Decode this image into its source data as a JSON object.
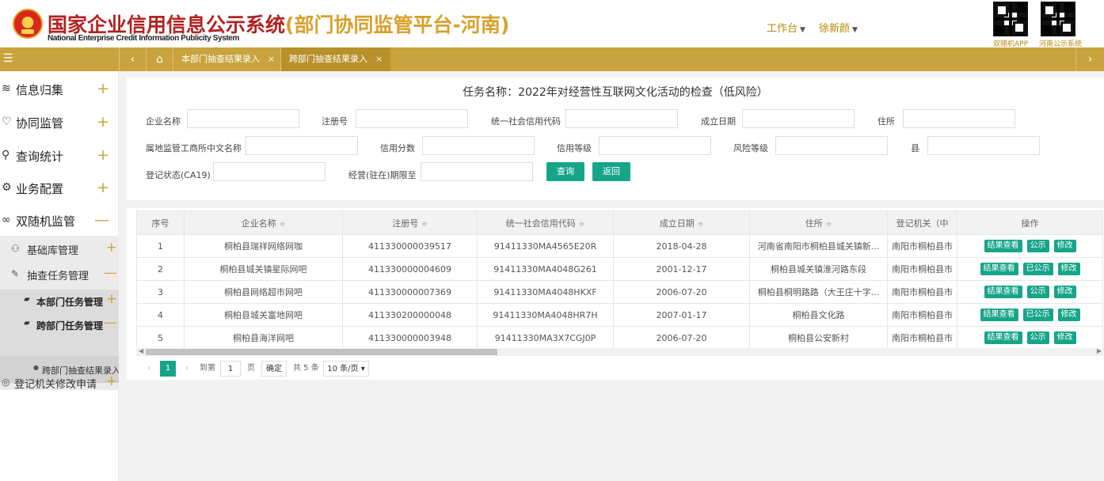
{
  "header": {
    "title_cn": "国家企业信用信息公示系统",
    "title_suffix": "(部门协同监管平台-河南)",
    "title_en": "National Enterprise Credit Information Publicity System",
    "workbench_label": "工作台",
    "user_label": "徐新颜",
    "qr1_label": "双随机APP",
    "qr2_label": "河南公示系统"
  },
  "tabbar": {
    "menu_icon": "☰",
    "prev_icon": "‹",
    "home_icon": "⌂",
    "next_icon": "›",
    "tabs": [
      {
        "label": "本部门抽查结果录入",
        "close": "×"
      },
      {
        "label": "跨部门抽查结果录入",
        "close": "×"
      }
    ]
  },
  "sidebar": {
    "items": [
      {
        "icon": "≋",
        "label": "信息归集",
        "toggle": "+"
      },
      {
        "icon": "♡",
        "label": "协同监管",
        "toggle": "+"
      },
      {
        "icon": "⚲",
        "label": "查询统计",
        "toggle": "+"
      },
      {
        "icon": "⚙",
        "label": "业务配置",
        "toggle": "+"
      },
      {
        "icon": "∞",
        "label": "双随机监管",
        "toggle": "—"
      }
    ],
    "sub": [
      {
        "icon": "⚇",
        "label": "基础库管理",
        "toggle": "+"
      },
      {
        "icon": "✎",
        "label": "抽查任务管理",
        "toggle": "—"
      }
    ],
    "sub3": [
      {
        "icon": "▰",
        "label": "本部门任务管理",
        "toggle": "+"
      },
      {
        "icon": "▰",
        "label": "跨部门任务管理",
        "toggle": "—"
      }
    ],
    "leaf": {
      "icon": "●",
      "label": "跨部门抽查结果录入"
    },
    "last": {
      "icon": "◎",
      "label": "登记机关修改申请",
      "toggle": "+"
    }
  },
  "main": {
    "task_title": "任务名称：2022年对经营性互联网文化活动的检查（低风险）",
    "fields": {
      "company_name": "企业名称",
      "reg_no": "注册号",
      "credit_code": "统一社会信用代码",
      "found_date": "成立日期",
      "address": "住所",
      "supervisor": "属地监管工商所中文名称",
      "credit_score": "信用分数",
      "credit_level": "信用等级",
      "risk_level": "风险等级",
      "county": "县",
      "reg_status": "登记状态(CA19)",
      "period_end": "经营(驻在)期限至"
    },
    "search_btn": "查询",
    "back_btn": "返回",
    "table": {
      "columns": [
        "序号",
        "企业名称",
        "注册号",
        "统一社会信用代码",
        "成立日期",
        "住所",
        "登记机关（中",
        "操作"
      ],
      "sort_icon": "≑",
      "rows": [
        {
          "no": "1",
          "name": "桐柏县瑞祥网络网咖",
          "reg": "411330000039517",
          "code": "91411330MA4565E20R",
          "date": "2018-04-28",
          "addr": "河南省南阳市桐柏县城关镇新...",
          "org": "南阳市桐柏县市",
          "actions": [
            "结果查看",
            "公示",
            "修改"
          ]
        },
        {
          "no": "2",
          "name": "桐柏县城关镇星际网吧",
          "reg": "411330000004609",
          "code": "91411330MA4048G261",
          "date": "2001-12-17",
          "addr": "桐柏县城关镇淮河路东段",
          "org": "南阳市桐柏县市",
          "actions": [
            "结果查看",
            "已公示",
            "修改"
          ]
        },
        {
          "no": "3",
          "name": "桐柏县网络超市网吧",
          "reg": "411330000007369",
          "code": "91411330MA4048HKXF",
          "date": "2006-07-20",
          "addr": "桐柏县桐明路路（大王庄十字...",
          "org": "南阳市桐柏县市",
          "actions": [
            "结果查看",
            "公示",
            "修改"
          ]
        },
        {
          "no": "4",
          "name": "桐柏县城关富地网吧",
          "reg": "411330200000048",
          "code": "91411330MA4048HR7H",
          "date": "2007-01-17",
          "addr": "桐柏县文化路",
          "org": "南阳市桐柏县市",
          "actions": [
            "结果查看",
            "已公示",
            "修改"
          ]
        },
        {
          "no": "5",
          "name": "桐柏县海洋网吧",
          "reg": "411330000003948",
          "code": "91411330MA3X7CGJ0P",
          "date": "2006-07-20",
          "addr": "桐柏县公安新村",
          "org": "南阳市桐柏县市",
          "actions": [
            "结果查看",
            "公示",
            "修改"
          ]
        }
      ]
    },
    "pager": {
      "prev": "‹",
      "current": "1",
      "next": "›",
      "goto_label": "到第",
      "goto_value": "1",
      "page_unit": "页",
      "confirm": "确定",
      "total": "共 5 条",
      "page_size": "10 条/页 ▾"
    }
  }
}
